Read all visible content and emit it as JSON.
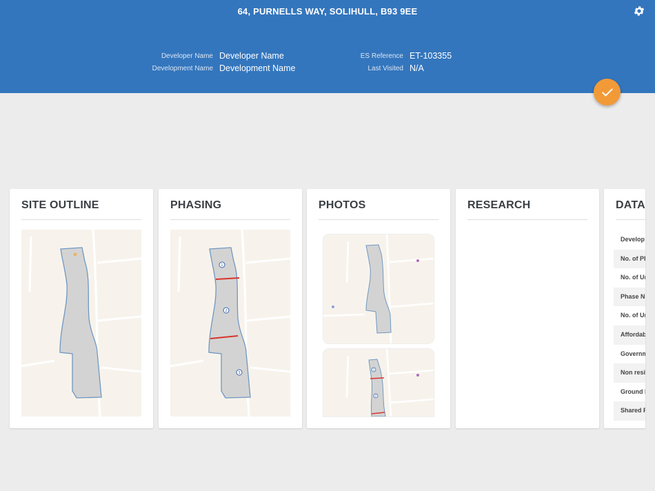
{
  "header": {
    "address": "64, PURNELLS WAY, SOLIHULL, B93 9EE",
    "developer_name_label": "Developer Name",
    "developer_name_value": "Developer Name",
    "development_name_label": "Development Name",
    "development_name_value": "Development Name",
    "es_reference_label": "ES Reference",
    "es_reference_value": "ET-103355",
    "last_visited_label": "Last Visited",
    "last_visited_value": "N/A",
    "settings_icon": "gear-icon"
  },
  "fab": {
    "icon": "checkmark-icon",
    "color": "#f29a38"
  },
  "colors": {
    "header": "#3476bd",
    "background": "#ececec",
    "phase_line": "#d9342b"
  },
  "cards": {
    "site_outline": {
      "title": "SITE OUTLINE"
    },
    "phasing": {
      "title": "PHASING",
      "phase_markers": [
        "1",
        "2",
        "3"
      ]
    },
    "photos": {
      "title": "PHOTOS",
      "thumb2_markers": [
        "1",
        "2"
      ]
    },
    "research": {
      "title": "RESEARCH"
    },
    "data": {
      "title": "DATA",
      "rows": [
        "Develop",
        "No. of Pl",
        "No. of Ur",
        "Phase N",
        "No. of Ur",
        "Affordab",
        "Governm",
        "Non resi",
        "Ground I",
        "Shared F"
      ]
    }
  }
}
